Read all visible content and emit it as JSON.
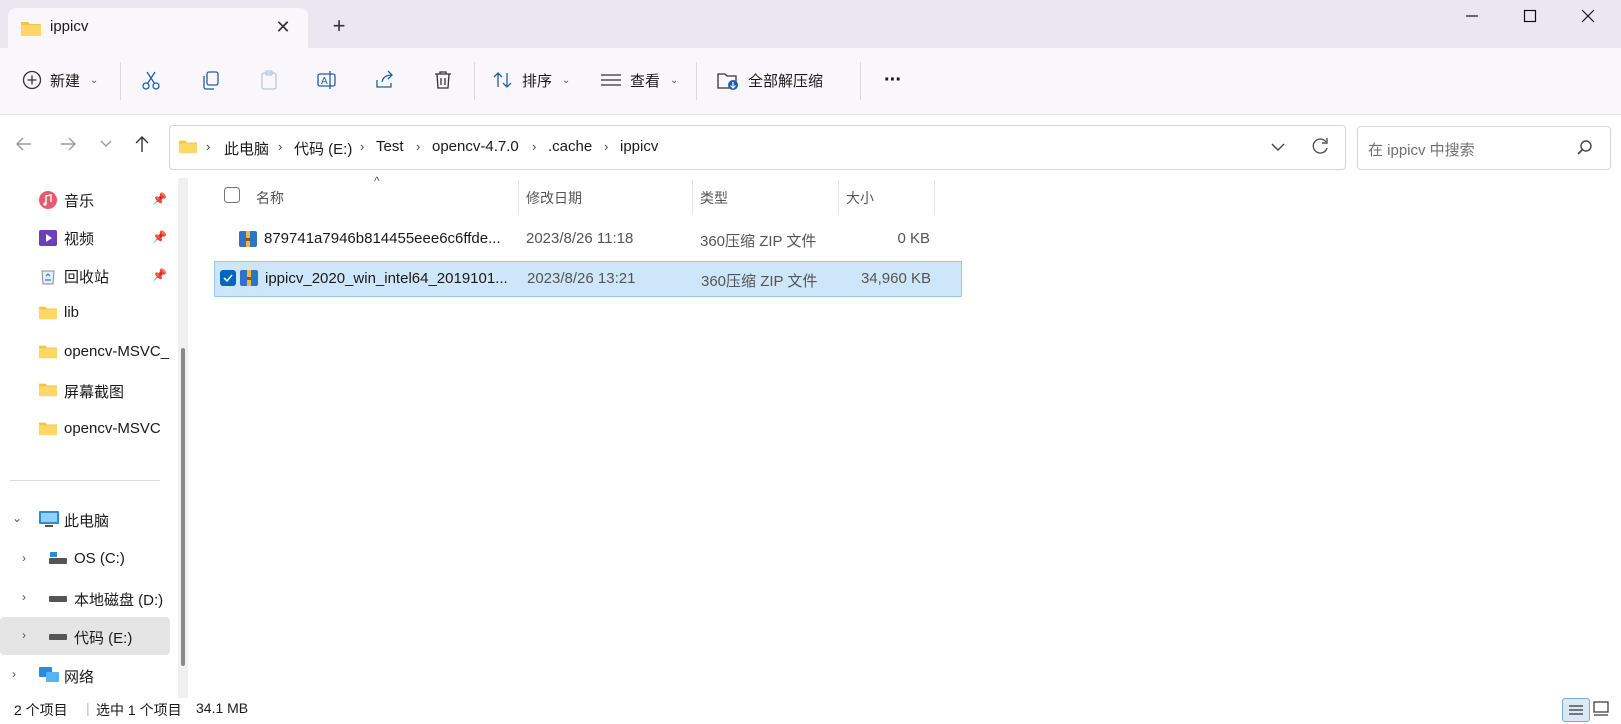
{
  "window": {
    "tab_title": "ippicv",
    "tab_close": "✕",
    "new_tab": "+"
  },
  "toolbar": {
    "new_label": "新建",
    "sort_label": "排序",
    "view_label": "查看",
    "extract_label": "全部解压缩",
    "more_label": "···"
  },
  "address": {
    "crumbs": [
      "此电脑",
      "代码 (E:)",
      "Test",
      "opencv-4.7.0",
      ".cache",
      "ippicv"
    ]
  },
  "search": {
    "placeholder": "在 ippicv 中搜索"
  },
  "sidebar": {
    "quick": [
      {
        "label": "音乐",
        "icon": "music-icon",
        "pinned": true
      },
      {
        "label": "视频",
        "icon": "video-icon",
        "pinned": true
      },
      {
        "label": "回收站",
        "icon": "recycle-bin-icon",
        "pinned": true
      },
      {
        "label": "lib",
        "icon": "folder-icon",
        "pinned": false
      },
      {
        "label": "opencv-MSVC_",
        "icon": "folder-icon",
        "pinned": false
      },
      {
        "label": "屏幕截图",
        "icon": "folder-icon",
        "pinned": false
      },
      {
        "label": "opencv-MSVC",
        "icon": "folder-icon",
        "pinned": false
      }
    ],
    "this_pc": "此电脑",
    "drives": [
      {
        "label": "OS (C:)"
      },
      {
        "label": "本地磁盘 (D:)"
      },
      {
        "label": "代码 (E:)"
      }
    ],
    "network": "网络"
  },
  "columns": {
    "name": "名称",
    "date": "修改日期",
    "type": "类型",
    "size": "大小"
  },
  "files": [
    {
      "name": "879741a7946b814455eee6c6ffde...",
      "date": "2023/8/26 11:18",
      "type": "360压缩 ZIP 文件",
      "size": "0 KB",
      "selected": false
    },
    {
      "name": "ippicv_2020_win_intel64_2019101...",
      "date": "2023/8/26 13:21",
      "type": "360压缩 ZIP 文件",
      "size": "34,960 KB",
      "selected": true
    }
  ],
  "status": {
    "count": "2 个项目",
    "selected": "选中 1 个项目",
    "size": "34.1 MB"
  },
  "colors": {
    "titlebar": "#ece6f1",
    "toolbar": "#f9f7fb",
    "selection": "#cde6fa",
    "accent": "#0067c0"
  }
}
